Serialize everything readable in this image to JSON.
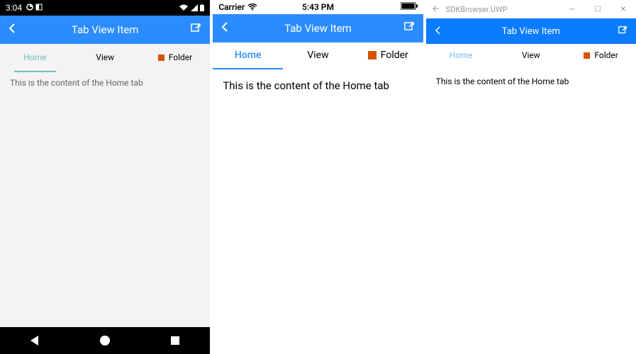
{
  "android": {
    "status": {
      "time": "3:04",
      "icons_left": "◔ ◧",
      "icons_right": "▾◢▮"
    },
    "header": {
      "title": "Tab View Item"
    },
    "tabs": [
      {
        "label": "Home",
        "active": true,
        "icon": null
      },
      {
        "label": "View",
        "active": false,
        "icon": null
      },
      {
        "label": "Folder",
        "active": false,
        "icon": "folder"
      }
    ],
    "content": "This is the content of the Home tab"
  },
  "ios": {
    "status": {
      "carrier": "Carrier",
      "time": "5:43 PM"
    },
    "header": {
      "title": "Tab View Item"
    },
    "tabs": [
      {
        "label": "Home",
        "active": true,
        "icon": null
      },
      {
        "label": "View",
        "active": false,
        "icon": null
      },
      {
        "label": "Folder",
        "active": false,
        "icon": "folder"
      }
    ],
    "content": "This is the content of the Home tab"
  },
  "uwp": {
    "titlebar": {
      "app": "SDKBrowser.UWP"
    },
    "header": {
      "title": "Tab View Item"
    },
    "tabs": [
      {
        "label": "Home",
        "active": true,
        "icon": null
      },
      {
        "label": "View",
        "active": false,
        "icon": null
      },
      {
        "label": "Folder",
        "active": false,
        "icon": "folder"
      }
    ],
    "content": "This is the content of the Home tab"
  }
}
